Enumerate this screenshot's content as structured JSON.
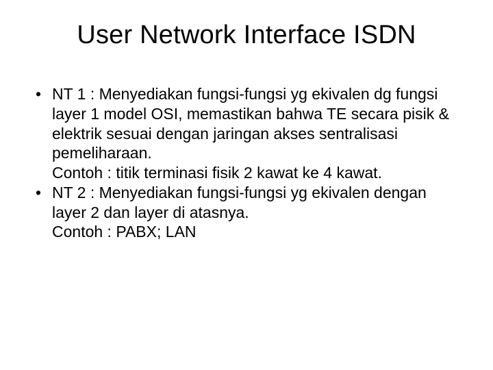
{
  "title": "User Network Interface ISDN",
  "bullets": [
    "NT 1 : Menyediakan fungsi-fungsi yg ekivalen dg fungsi layer 1 model OSI, memastikan bahwa TE secara pisik & elektrik sesuai dengan jaringan akses sentralisasi pemeliharaan.\nContoh   : titik terminasi fisik 2 kawat ke 4 kawat.",
    "NT 2 : Menyediakan fungsi-fungsi yg ekivalen dengan layer 2 dan layer di atasnya.\nContoh : PABX; LAN"
  ]
}
